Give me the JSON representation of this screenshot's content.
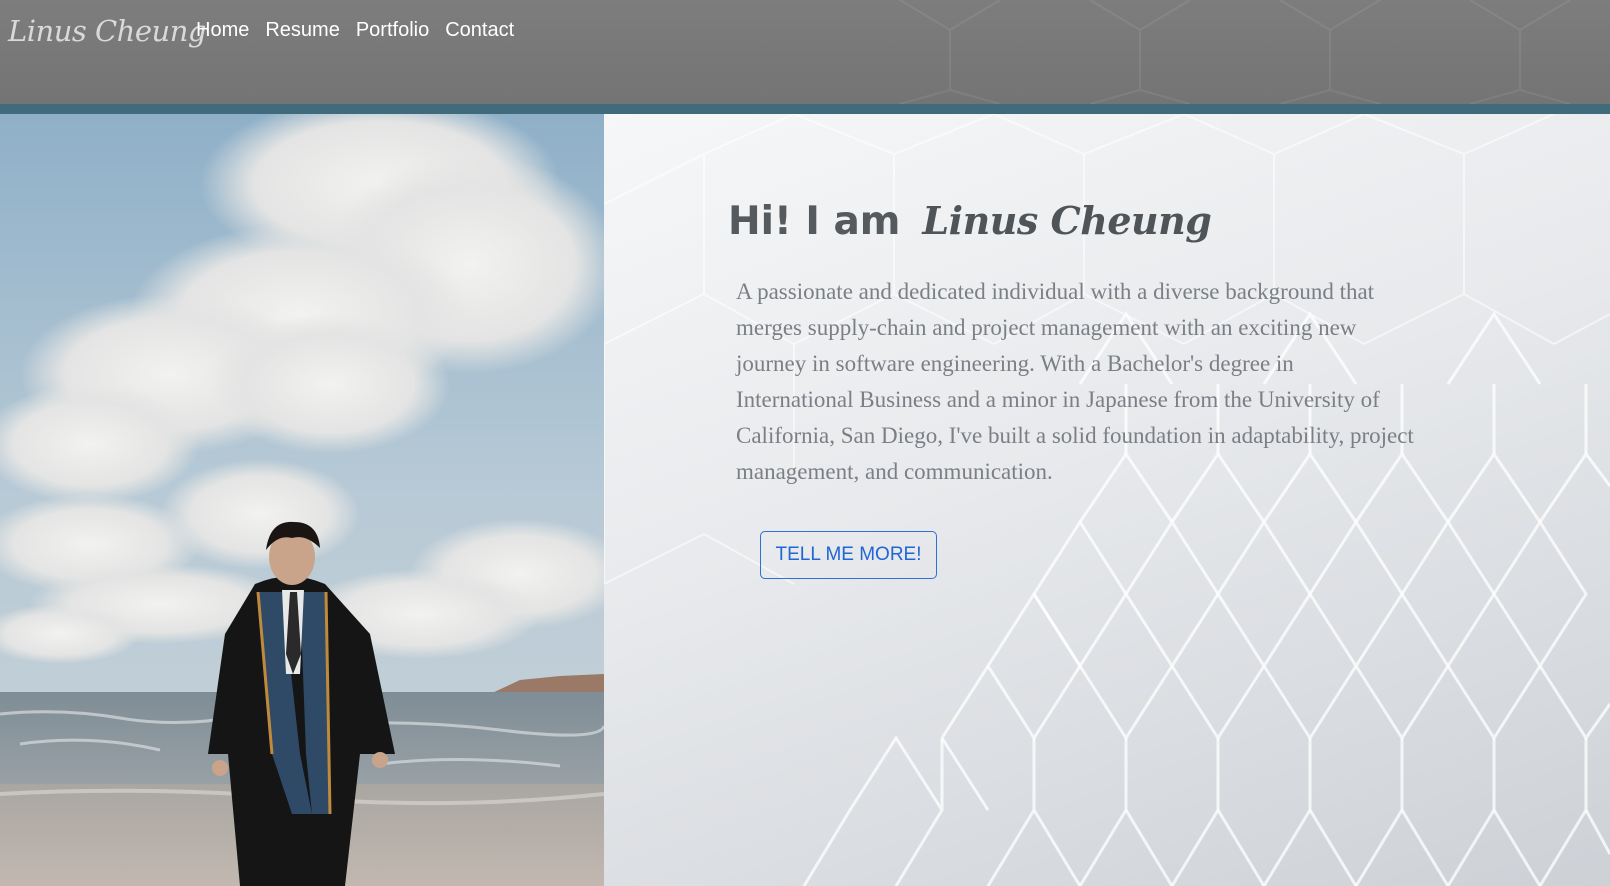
{
  "site": {
    "logo_text": "Linus Cheung"
  },
  "nav": {
    "items": [
      {
        "label": "Home"
      },
      {
        "label": "Resume"
      },
      {
        "label": "Portfolio"
      },
      {
        "label": "Contact"
      }
    ]
  },
  "hero": {
    "greeting": "Hi! I am",
    "name": "Linus Cheung",
    "description": "A passionate and dedicated individual with a diverse background that merges supply-chain and project management with an exciting new journey in software engineering. With a Bachelor's degree in International Business and a minor in Japanese from the University of California, San Diego, I've built a solid foundation in adaptability, project management, and communication.",
    "cta_label": "TELL ME MORE!"
  },
  "colors": {
    "header_bg": "#7a7a7a",
    "accent_bar": "#3f6b7b",
    "cta_blue": "#1f66d6",
    "title_text": "#555a5e",
    "body_text": "#7b7f84"
  }
}
